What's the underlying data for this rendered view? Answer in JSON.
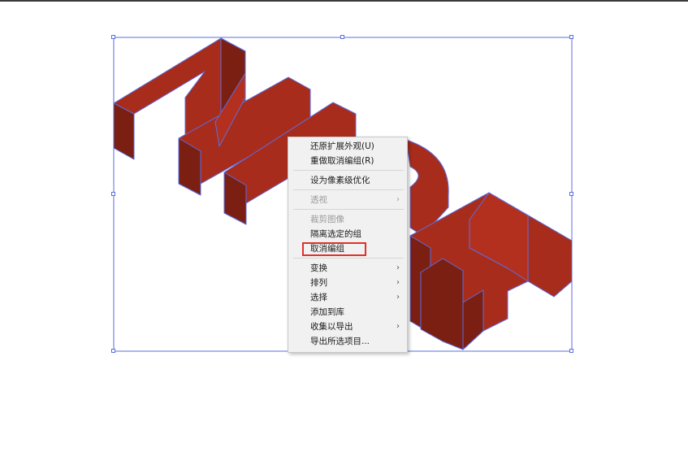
{
  "canvas": {
    "artwork": "3d-isometric-letters",
    "colors": {
      "face_top": "#b3301e",
      "face_front": "#a82c1c",
      "face_side": "#7a1f12",
      "stroke": "#5b6ee1",
      "selection": "#5b6ee1"
    }
  },
  "context_menu": {
    "items": [
      {
        "label": "还原扩展外观(U)",
        "enabled": true,
        "submenu": false
      },
      {
        "label": "重做取消编组(R)",
        "enabled": true,
        "submenu": false
      },
      {
        "label": "设为像素级优化",
        "enabled": true,
        "submenu": false
      },
      {
        "label": "透视",
        "enabled": false,
        "submenu": true
      },
      {
        "label": "裁剪图像",
        "enabled": false,
        "submenu": false
      },
      {
        "label": "隔离选定的组",
        "enabled": true,
        "submenu": false
      },
      {
        "label": "取消编组",
        "enabled": true,
        "submenu": false,
        "highlighted": true
      },
      {
        "label": "变换",
        "enabled": true,
        "submenu": true
      },
      {
        "label": "排列",
        "enabled": true,
        "submenu": true
      },
      {
        "label": "选择",
        "enabled": true,
        "submenu": true
      },
      {
        "label": "添加到库",
        "enabled": true,
        "submenu": false
      },
      {
        "label": "收集以导出",
        "enabled": true,
        "submenu": true
      },
      {
        "label": "导出所选项目...",
        "enabled": true,
        "submenu": false
      }
    ],
    "highlight_color": "#e2302a",
    "submenu_arrow": "›"
  }
}
